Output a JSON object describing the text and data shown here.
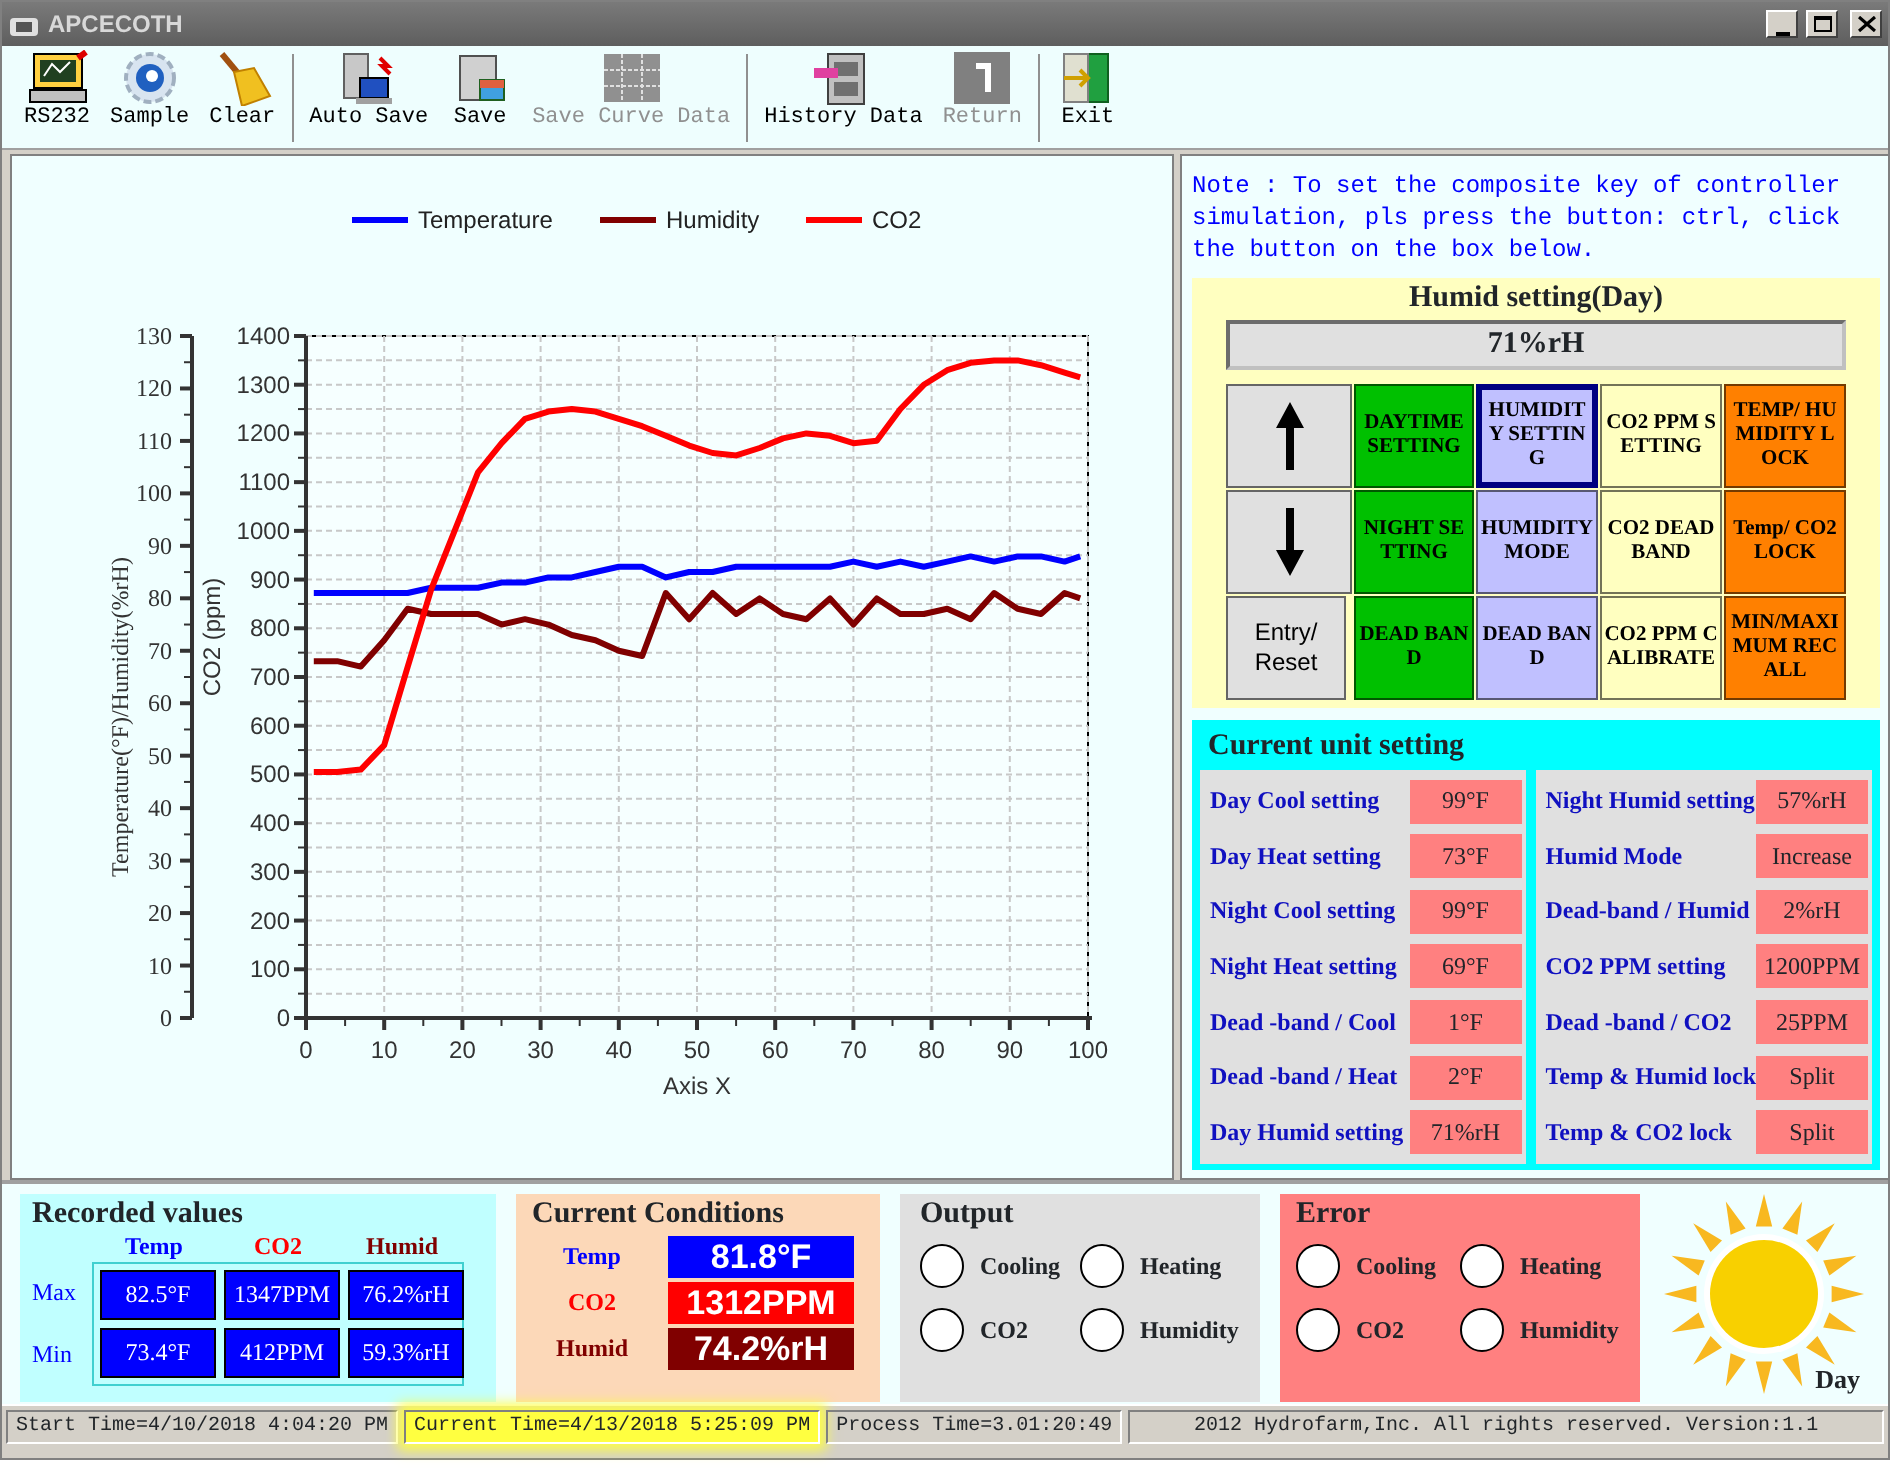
{
  "window": {
    "title": "APCECOTH"
  },
  "toolbar": [
    {
      "label": "RS232",
      "disabled": false,
      "separator_after": false
    },
    {
      "label": "Sample",
      "disabled": false,
      "separator_after": false
    },
    {
      "label": "Clear",
      "disabled": false,
      "separator_after": true
    },
    {
      "label": "Auto Save",
      "disabled": false,
      "separator_after": false
    },
    {
      "label": "Save",
      "disabled": false,
      "separator_after": false
    },
    {
      "label": "Save Curve Data",
      "disabled": true,
      "separator_after": true
    },
    {
      "label": "History Data",
      "disabled": false,
      "separator_after": false
    },
    {
      "label": "Return",
      "disabled": true,
      "separator_after": true
    },
    {
      "label": "Exit",
      "disabled": false,
      "separator_after": false
    }
  ],
  "chart": {
    "chart_data": {
      "type": "line",
      "xlabel": "Axis X",
      "ylabel": "Temperature(°F)/Humidity(%rH)",
      "y2label": "CO2 (ppm)",
      "x": [
        1,
        4,
        7,
        10,
        13,
        16,
        19,
        22,
        25,
        28,
        31,
        34,
        37,
        40,
        43,
        46,
        49,
        52,
        55,
        58,
        61,
        64,
        67,
        70,
        73,
        76,
        79,
        82,
        85,
        88,
        91,
        94,
        97,
        99
      ],
      "grid": true,
      "legend": "top",
      "xlim": [
        0,
        100
      ],
      "ylim": [
        0,
        130
      ],
      "y2lim": [
        0,
        1400
      ],
      "xticks": [
        0,
        10,
        20,
        30,
        40,
        50,
        60,
        70,
        80,
        90,
        100
      ],
      "yticks": [
        0,
        10,
        20,
        30,
        40,
        50,
        60,
        70,
        80,
        90,
        100,
        110,
        120,
        130
      ],
      "y2ticks": [
        0,
        100,
        200,
        300,
        400,
        500,
        600,
        700,
        800,
        900,
        1000,
        1100,
        1200,
        1300,
        1400
      ],
      "series": [
        {
          "name": "Temperature",
          "color": "#0000ff",
          "values": [
            81,
            81,
            81,
            81,
            81,
            82,
            82,
            82,
            83,
            83,
            84,
            84,
            85,
            86,
            86,
            84,
            85,
            85,
            86,
            86,
            86,
            86,
            86,
            87,
            86,
            87,
            86,
            87,
            88,
            87,
            88,
            88,
            87,
            88
          ]
        },
        {
          "name": "Humidity",
          "color": "#800000",
          "values": [
            68,
            68,
            67,
            72,
            78,
            77,
            77,
            77,
            75,
            76,
            75,
            73,
            72,
            70,
            69,
            81,
            76,
            81,
            77,
            80,
            77,
            76,
            80,
            75,
            80,
            77,
            77,
            78,
            76,
            81,
            78,
            77,
            81,
            80
          ]
        },
        {
          "name": "CO2",
          "color": "#ff0000",
          "axis": "y2",
          "values": [
            505,
            505,
            510,
            560,
            720,
            880,
            1000,
            1120,
            1180,
            1230,
            1245,
            1250,
            1245,
            1230,
            1215,
            1195,
            1175,
            1160,
            1155,
            1170,
            1190,
            1200,
            1195,
            1180,
            1185,
            1250,
            1300,
            1330,
            1345,
            1350,
            1350,
            1340,
            1325,
            1315
          ]
        }
      ]
    }
  },
  "note": "Note : To set the composite key of controller simulation, pls press the button: ctrl, click the button on the box below.",
  "keypad": {
    "title": "Humid setting(Day)",
    "display": "71%rH",
    "keys": [
      {
        "kind": "up",
        "color": "#e0e0e0",
        "selected": false
      },
      {
        "kind": "text",
        "label": "DAYTIME SETTING",
        "color": "#00c000",
        "selected": false
      },
      {
        "kind": "text",
        "label": "HUMIDITY SETTING",
        "color": "#c0c0ff",
        "selected": true
      },
      {
        "kind": "text",
        "label": "CO2  PPM SETTING",
        "color": "#ffffc0",
        "selected": false
      },
      {
        "kind": "text",
        "label": "TEMP/ HUMIDITY LOCK",
        "color": "#ff8000",
        "selected": false
      },
      {
        "kind": "down",
        "color": "#e0e0e0",
        "selected": false
      },
      {
        "kind": "text",
        "label": "NIGHT SETTING",
        "color": "#00c000",
        "selected": false
      },
      {
        "kind": "text",
        "label": "HUMIDITY MODE",
        "color": "#c0c0ff",
        "selected": false
      },
      {
        "kind": "text",
        "label": "CO2 DEAD BAND",
        "color": "#ffffc0",
        "selected": false
      },
      {
        "kind": "text",
        "label": "Temp/ CO2 LOCK",
        "color": "#ff8000",
        "selected": false
      },
      {
        "kind": "plain",
        "label": "Entry/ Reset",
        "color": "#e0e0e0",
        "selected": false
      },
      {
        "kind": "text",
        "label": "DEAD BAND",
        "color": "#00c000",
        "selected": false
      },
      {
        "kind": "text",
        "label": "DEAD BAND",
        "color": "#c0c0ff",
        "selected": false
      },
      {
        "kind": "text",
        "label": "CO2 PPM CALIBRATE",
        "color": "#ffffc0",
        "selected": false
      },
      {
        "kind": "text",
        "label": "MIN/MAXIMUM RECALL",
        "color": "#ff8000",
        "selected": false
      }
    ]
  },
  "unit_settings": {
    "title": "Current unit setting",
    "left": [
      {
        "label": "Day Cool setting",
        "value": "99°F"
      },
      {
        "label": "Day Heat setting",
        "value": "73°F"
      },
      {
        "label": "Night Cool setting",
        "value": "99°F"
      },
      {
        "label": "Night Heat setting",
        "value": "69°F"
      },
      {
        "label": "Dead -band / Cool",
        "value": "1°F"
      },
      {
        "label": "Dead -band / Heat",
        "value": "2°F"
      },
      {
        "label": "Day Humid setting",
        "value": "71%rH"
      }
    ],
    "right": [
      {
        "label": "Night Humid setting",
        "value": "57%rH"
      },
      {
        "label": "Humid Mode",
        "value": "Increase"
      },
      {
        "label": "Dead-band / Humid",
        "value": "2%rH"
      },
      {
        "label": "CO2 PPM setting",
        "value": "1200PPM"
      },
      {
        "label": "Dead -band / CO2",
        "value": "25PPM"
      },
      {
        "label": "Temp & Humid lock",
        "value": "Split"
      },
      {
        "label": "Temp & CO2 lock",
        "value": "Split"
      }
    ]
  },
  "recorded": {
    "title": "Recorded values",
    "columns": [
      {
        "label": "Temp",
        "color": "#0000ff"
      },
      {
        "label": "CO2",
        "color": "#ff0000"
      },
      {
        "label": "Humid",
        "color": "#800000"
      }
    ],
    "rows": [
      {
        "label": "Max",
        "values": [
          "82.5°F",
          "1347PPM",
          "76.2%rH"
        ]
      },
      {
        "label": "Min",
        "values": [
          "73.4°F",
          "412PPM",
          "59.3%rH"
        ]
      }
    ]
  },
  "current": {
    "title": "Current  Conditions",
    "rows": [
      {
        "label": "Temp",
        "value": "81.8°F",
        "color": "#0000ff"
      },
      {
        "label": "CO2",
        "value": "1312PPM",
        "color": "#ff0000"
      },
      {
        "label": "Humid",
        "value": "74.2%rH",
        "color": "#800000"
      }
    ]
  },
  "output": {
    "title": "Output",
    "indicators": [
      {
        "label": "Cooling",
        "on": false
      },
      {
        "label": "Heating",
        "on": false
      },
      {
        "label": "CO2",
        "on": false
      },
      {
        "label": "Humidity",
        "on": false
      }
    ]
  },
  "error": {
    "title": "Error",
    "indicators": [
      {
        "label": "Cooling",
        "on": false
      },
      {
        "label": "Heating",
        "on": false
      },
      {
        "label": "CO2",
        "on": false
      },
      {
        "label": "Humidity",
        "on": false
      }
    ]
  },
  "mode": {
    "label": "Day"
  },
  "status_bar": [
    {
      "text": "Start Time=4/10/2018 4:04:20 PM",
      "highlighted": false
    },
    {
      "text": "Current Time=4/13/2018 5:25:09 PM",
      "highlighted": true
    },
    {
      "text": "Process Time=3.01:20:49",
      "highlighted": false
    },
    {
      "text": "2012 Hydrofarm,Inc. All rights reserved. Version:1.1",
      "highlighted": false
    }
  ]
}
